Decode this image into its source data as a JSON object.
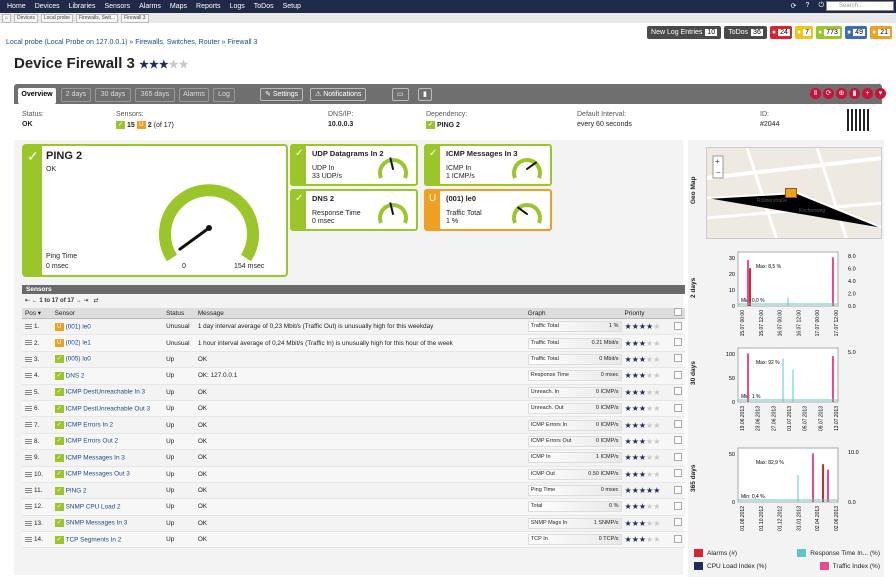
{
  "topnav": {
    "items": [
      "Home",
      "Devices",
      "Libraries",
      "Sensors",
      "Alarms",
      "Maps",
      "Reports",
      "Logs",
      "ToDos",
      "Setup"
    ],
    "search_placeholder": "Search..."
  },
  "breadcrumb_tabs": [
    "Devices",
    "Local probe",
    "Firewalls, Swit...",
    "Firewall 3"
  ],
  "path": {
    "probe": "Local probe (Local Probe on 127.0.0.1)",
    "group": "Firewalls, Switches, Router",
    "device": "Firewall 3",
    "sep": "»"
  },
  "statusbar": {
    "new_log_label": "New Log Entries",
    "new_log_count": "10",
    "todos_label": "ToDos",
    "todos_count": "36",
    "badges": [
      {
        "count": "24",
        "color": "#d9232d"
      },
      {
        "count": "7",
        "color": "#f0c419"
      },
      {
        "count": "773",
        "color": "#9ac62a"
      },
      {
        "count": "49",
        "color": "#3a6fb7"
      },
      {
        "count": "21",
        "color": "#f0a020"
      }
    ]
  },
  "device": {
    "title": "Device Firewall 3",
    "stars": 3,
    "stars_total": 5
  },
  "tabs": {
    "items": [
      "Overview",
      "2 days",
      "30 days",
      "365 days",
      "Alarms",
      "Log"
    ],
    "settings": "Settings",
    "notifications": "Notifications"
  },
  "info": {
    "status_label": "Status:",
    "status": "OK",
    "sensors_label": "Sensors:",
    "sensors_up": "15",
    "sensors_unusual": "2",
    "sensors_of": "(of 17)",
    "dns_label": "DNS/IP:",
    "dns": "10.0.0.3",
    "dep_label": "Dependency:",
    "dep": "PING 2",
    "interval_label": "Default Interval:",
    "interval": "every 60 seconds",
    "id_label": "ID:",
    "id": "#2044"
  },
  "big_gauge": {
    "title": "PING 2",
    "status": "OK",
    "label": "Ping Time",
    "value": "0 msec",
    "min": "0",
    "max": "154 msec",
    "level": 0.3
  },
  "gauges": [
    {
      "title": "UDP Datagrams In 2",
      "l1": "UDP In",
      "l2": "33 UDP/s",
      "state": "up",
      "level": 0.45
    },
    {
      "title": "ICMP Messages In 3",
      "l1": "ICMP In",
      "l2": "1 ICMP/s",
      "state": "up",
      "level": 0.7
    },
    {
      "title": "DNS 2",
      "l1": "Response Time",
      "l2": "0 msec",
      "state": "up",
      "level": 0.45
    },
    {
      "title": "(001) le0",
      "l1": "Traffic Total",
      "l2": "1 %",
      "state": "unusual",
      "level": 0.3
    }
  ],
  "sensors": {
    "header": "Sensors",
    "pager": "1 to 17 of 17",
    "cols": [
      "Pos",
      "Sensor",
      "Status",
      "Message",
      "Graph",
      "Priority"
    ],
    "rows": [
      {
        "pos": "1.",
        "name": "(001) le0",
        "st": "Unusual",
        "msg": "1 day interval average of 0,23 Mbit/s (Traffic Out) is unusually high for this weekday",
        "gl": "Traffic Total",
        "gv": "1 %",
        "pr": 4,
        "ind": "un"
      },
      {
        "pos": "2.",
        "name": "(002) le1",
        "st": "Unusual",
        "msg": "1 hour interval average of 0,24 Mbit/s (Traffic In) is unusually high for this hour of the week",
        "gl": "Traffic Total",
        "gv": "0.21 Mbit/s",
        "pr": 3,
        "ind": "un"
      },
      {
        "pos": "3.",
        "name": "(005) lo0",
        "st": "Up",
        "msg": "OK",
        "gl": "Traffic Total",
        "gv": "0 Mbit/s",
        "pr": 3,
        "ind": "up"
      },
      {
        "pos": "4.",
        "name": "DNS 2",
        "st": "Up",
        "msg": "OK: 127.0.0.1",
        "gl": "Response Time",
        "gv": "0 msec",
        "pr": 3,
        "ind": "up"
      },
      {
        "pos": "5.",
        "name": "ICMP DestUnreachable In 3",
        "st": "Up",
        "msg": "OK",
        "gl": "Unreach. In",
        "gv": "0 ICMP/s",
        "pr": 3,
        "ind": "up"
      },
      {
        "pos": "6.",
        "name": "ICMP DestUnreachable Out 3",
        "st": "Up",
        "msg": "OK",
        "gl": "Unreach. Out",
        "gv": "0 ICMP/s",
        "pr": 3,
        "ind": "up"
      },
      {
        "pos": "7.",
        "name": "ICMP Errors In 2",
        "st": "Up",
        "msg": "OK",
        "gl": "ICMP Errors In",
        "gv": "0 ICMP/s",
        "pr": 3,
        "ind": "up"
      },
      {
        "pos": "8.",
        "name": "ICMP Errors Out 2",
        "st": "Up",
        "msg": "OK",
        "gl": "ICMP Errors Out",
        "gv": "0 ICMP/s",
        "pr": 3,
        "ind": "up"
      },
      {
        "pos": "9.",
        "name": "ICMP Messages In 3",
        "st": "Up",
        "msg": "OK",
        "gl": "ICMP In",
        "gv": "1 ICMP/s",
        "pr": 3,
        "ind": "up"
      },
      {
        "pos": "10.",
        "name": "ICMP Messages Out 3",
        "st": "Up",
        "msg": "OK",
        "gl": "ICMP Out",
        "gv": "0.50 ICMP/s",
        "pr": 3,
        "ind": "up"
      },
      {
        "pos": "11.",
        "name": "PING 2",
        "st": "Up",
        "msg": "OK",
        "gl": "Ping Time",
        "gv": "0 msec",
        "pr": 5,
        "ind": "up"
      },
      {
        "pos": "12.",
        "name": "SNMP CPU Load 2",
        "st": "Up",
        "msg": "OK",
        "gl": "Total",
        "gv": "0 %",
        "pr": 3,
        "ind": "up"
      },
      {
        "pos": "13.",
        "name": "SNMP Messages In 3",
        "st": "Up",
        "msg": "OK",
        "gl": "SNMP Msgs In",
        "gv": "1 SNMP/s",
        "pr": 3,
        "ind": "up"
      },
      {
        "pos": "14.",
        "name": "TCP Segments In 2",
        "st": "Up",
        "msg": "OK",
        "gl": "TCP In",
        "gv": "0 TCP/s",
        "pr": 3,
        "ind": "up"
      }
    ]
  },
  "side": {
    "geo": "Geo Map",
    "d2": "2 days",
    "d30": "30 days",
    "d365": "365 days",
    "c2": {
      "ticks_y": [
        "30",
        "20",
        "10",
        "0"
      ],
      "ticks_r": [
        "8.0",
        "6.0",
        "4.0",
        "2.0",
        "0.0"
      ],
      "max": "Max: 8,5 %",
      "min": "Min: 0,0 %",
      "x": [
        "15.07 00:00",
        "15.07 12:00",
        "16.07 00:00",
        "16.07 12:00",
        "17.07 00:00",
        "17.07 12:00"
      ]
    },
    "c30": {
      "ticks_y": [
        "100",
        "50",
        "0"
      ],
      "ticks_r": [
        "5.0"
      ],
      "max": "Max: 92 %",
      "min": "Min: 1 %",
      "x": [
        "19.06.2013",
        "23.06.2013",
        "27.06.2013",
        "01.07.2013",
        "05.07.2013",
        "09.07.2013",
        "13.07.2013"
      ]
    },
    "c365": {
      "ticks_y": [
        "50",
        "0"
      ],
      "ticks_r": [
        "10.0",
        "0.0"
      ],
      "max": "Max: 82,9 %",
      "min": "Min: 0,4 %",
      "x": [
        "01.08.2012",
        "01.10.2012",
        "01.12.2012",
        "31.01.2013",
        "02.04.2013",
        "02.06.2013"
      ]
    },
    "legend": [
      {
        "label": "Alarms",
        "unit": "(#)",
        "color": "#d9232d"
      },
      {
        "label": "Response Time In...",
        "unit": "(%)",
        "color": "#5ac8c8"
      },
      {
        "label": "CPU Load Index",
        "unit": "(%)",
        "color": "#1e2d5a"
      },
      {
        "label": "Traffic Index",
        "unit": "(%)",
        "color": "#e84a8a"
      }
    ],
    "map_streets": [
      "Kirchenweg",
      "Rollnerstraße"
    ]
  }
}
